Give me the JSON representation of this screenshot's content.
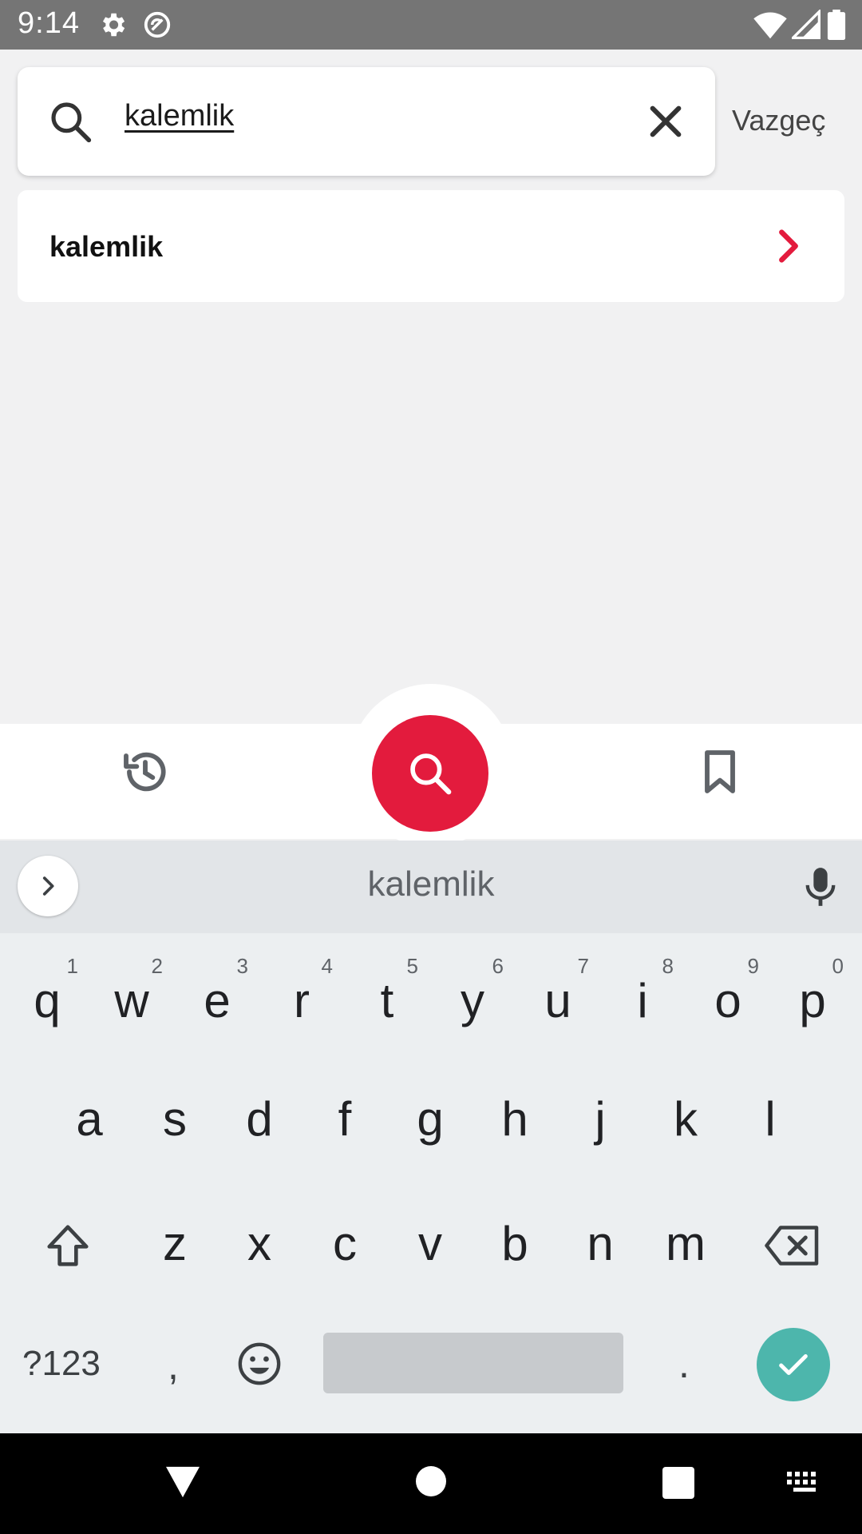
{
  "status_bar": {
    "time": "9:14",
    "icons": [
      "settings-icon",
      "data-saver-icon",
      "wifi-icon",
      "signal-icon",
      "battery-icon"
    ]
  },
  "search": {
    "query": "kalemlik",
    "cancel_label": "Vazgeç"
  },
  "suggestions": [
    {
      "label": "kalemlik"
    }
  ],
  "bottom_nav": {
    "items": [
      "history-icon",
      "search-icon",
      "bookmark-icon"
    ],
    "accent_color": "#e31b3d"
  },
  "keyboard": {
    "suggestion": "kalemlik",
    "row1": [
      {
        "key": "q",
        "hint": "1"
      },
      {
        "key": "w",
        "hint": "2"
      },
      {
        "key": "e",
        "hint": "3"
      },
      {
        "key": "r",
        "hint": "4"
      },
      {
        "key": "t",
        "hint": "5"
      },
      {
        "key": "y",
        "hint": "6"
      },
      {
        "key": "u",
        "hint": "7"
      },
      {
        "key": "i",
        "hint": "8"
      },
      {
        "key": "o",
        "hint": "9"
      },
      {
        "key": "p",
        "hint": "0"
      }
    ],
    "row2": [
      "a",
      "s",
      "d",
      "f",
      "g",
      "h",
      "j",
      "k",
      "l"
    ],
    "row3": [
      "z",
      "x",
      "c",
      "v",
      "b",
      "n",
      "m"
    ],
    "symbols_label": "?123",
    "comma": ",",
    "period": ".",
    "enter_color": "#4db6ac"
  }
}
